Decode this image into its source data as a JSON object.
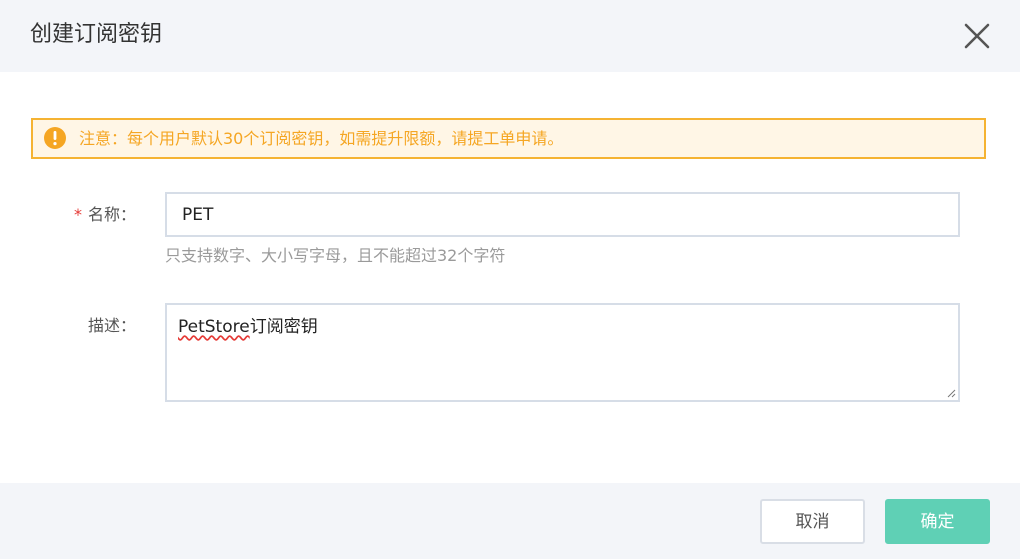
{
  "dialog": {
    "title": "创建订阅密钥",
    "close_icon": "close-icon"
  },
  "alert": {
    "icon": "warning-icon",
    "text": "注意：每个用户默认30个订阅密钥，如需提升限额，请提工单申请。",
    "color": "#f5a623",
    "border_color": "#f5b332",
    "background": "#fff6e6"
  },
  "form": {
    "name": {
      "required_mark": "*",
      "label": "名称：",
      "value": "PET",
      "hint": "只支持数字、大小写字母，且不能超过32个字符"
    },
    "description": {
      "label": "描述：",
      "value_misspelled": "PetStore",
      "value_rest": "订阅密钥"
    }
  },
  "footer": {
    "cancel_label": "取消",
    "ok_label": "确定",
    "ok_color": "#5fd0b5"
  }
}
